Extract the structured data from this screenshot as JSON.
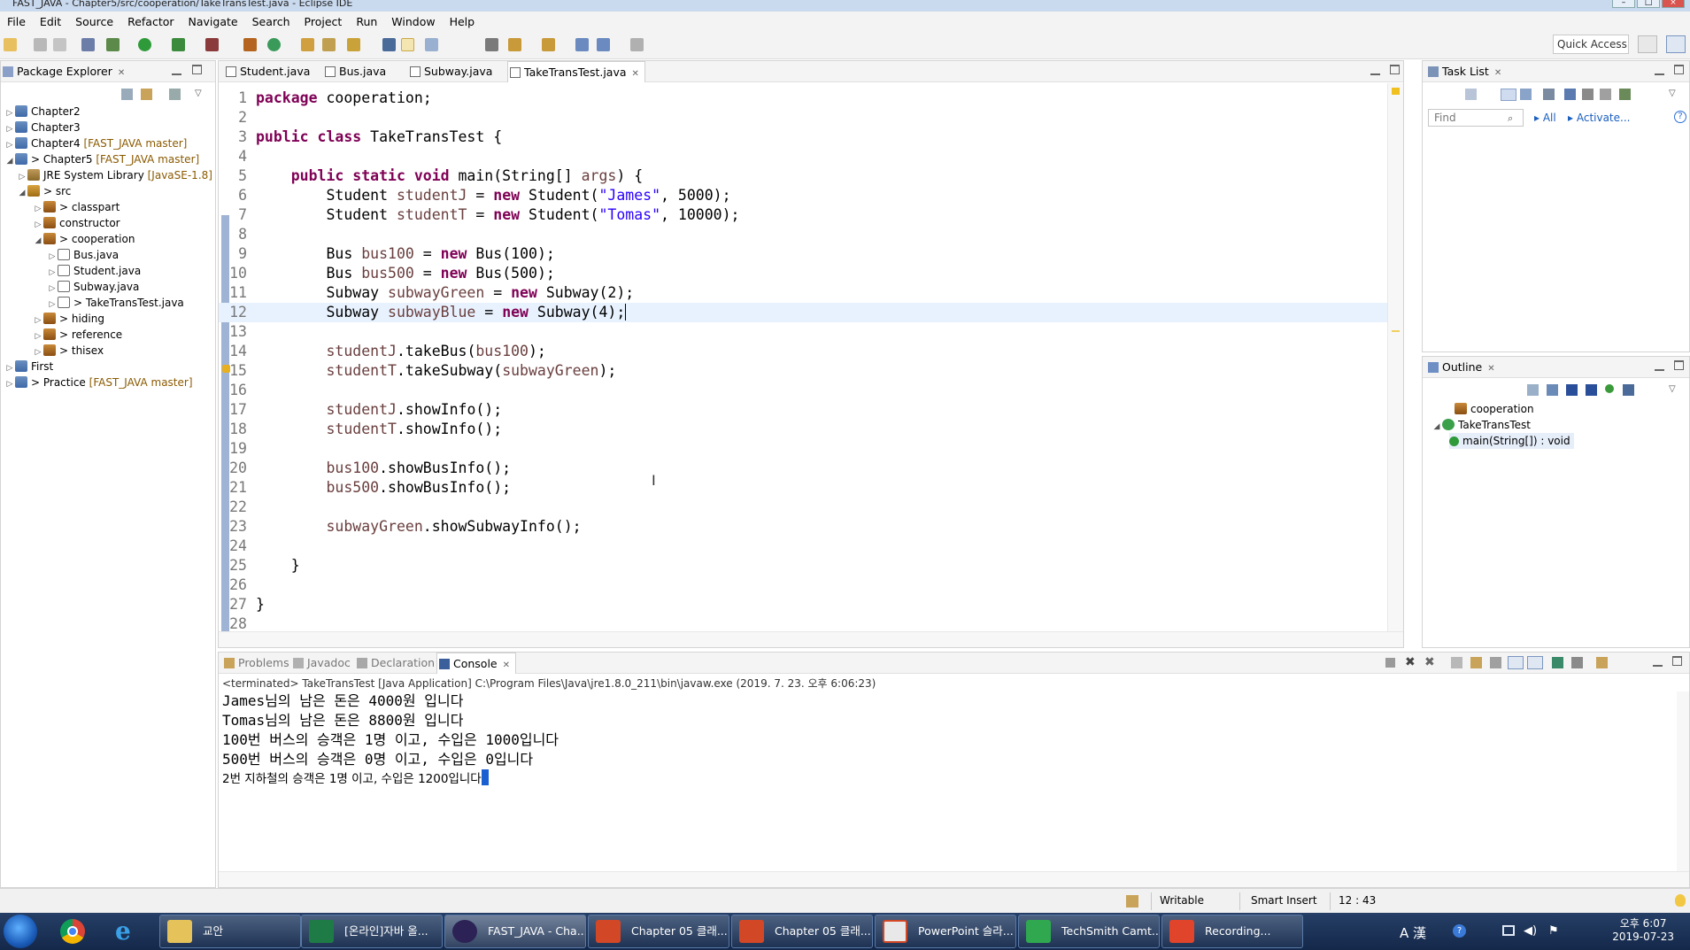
{
  "window": {
    "title": "FAST_JAVA - Chapter5/src/cooperation/TakeTransTest.java - Eclipse IDE"
  },
  "menu": [
    "File",
    "Edit",
    "Source",
    "Refactor",
    "Navigate",
    "Search",
    "Project",
    "Run",
    "Window",
    "Help"
  ],
  "toolbar": {
    "quick_access": "Quick Access"
  },
  "package_explorer": {
    "title": "Package Explorer",
    "items": [
      {
        "label": "Chapter2",
        "deco": ""
      },
      {
        "label": "Chapter3",
        "deco": ""
      },
      {
        "label": "Chapter4",
        "deco": "[FAST_JAVA master]"
      },
      {
        "label": "> Chapter5",
        "deco": "[FAST_JAVA master]"
      },
      {
        "label": "JRE System Library",
        "deco": "[JavaSE-1.8]"
      },
      {
        "label": "> src",
        "deco": ""
      },
      {
        "label": "> classpart",
        "deco": ""
      },
      {
        "label": "constructor",
        "deco": ""
      },
      {
        "label": "> cooperation",
        "deco": ""
      },
      {
        "label": "Bus.java",
        "deco": ""
      },
      {
        "label": "Student.java",
        "deco": ""
      },
      {
        "label": "Subway.java",
        "deco": ""
      },
      {
        "label": "> TakeTransTest.java",
        "deco": ""
      },
      {
        "label": "> hiding",
        "deco": ""
      },
      {
        "label": "> reference",
        "deco": ""
      },
      {
        "label": "> thisex",
        "deco": ""
      },
      {
        "label": "First",
        "deco": ""
      },
      {
        "label": "> Practice",
        "deco": "[FAST_JAVA master]"
      }
    ]
  },
  "editor": {
    "tabs": [
      "Student.java",
      "Bus.java",
      "Subway.java",
      "TakeTransTest.java"
    ],
    "lines": [
      "1",
      "2",
      "3",
      "4",
      "5",
      "6",
      "7",
      "8",
      "9",
      "10",
      "11",
      "12",
      "13",
      "14",
      "15",
      "16",
      "17",
      "18",
      "19",
      "20",
      "21",
      "22",
      "23",
      "24",
      "25",
      "26",
      "27",
      "28"
    ],
    "code": {
      "l1_kw": "package",
      "l1_rest": " cooperation;",
      "l3_kw": "public class",
      "l3_rest": " TakeTransTest {",
      "l5_kw": "public static void",
      "l5_rest": " main(String[] ",
      "l5_args": "args",
      "l5_end": ") {",
      "l6_pre": "Student ",
      "l6_var": "studentJ",
      "l6_eq": " = ",
      "l6_new": "new",
      "l6_mid": " Student(",
      "l6_str": "\"James\"",
      "l6_end": ", 5000);",
      "l7_pre": "Student ",
      "l7_var": "studentT",
      "l7_eq": " = ",
      "l7_new": "new",
      "l7_mid": " Student(",
      "l7_str": "\"Tomas\"",
      "l7_end": ", 10000);",
      "l9_pre": "Bus ",
      "l9_var": "bus100",
      "l9_eq": " = ",
      "l9_new": "new",
      "l9_end": " Bus(100);",
      "l10_pre": "Bus ",
      "l10_var": "bus500",
      "l10_eq": " = ",
      "l10_new": "new",
      "l10_end": " Bus(500);",
      "l11_pre": "Subway ",
      "l11_var": "subwayGreen",
      "l11_eq": " = ",
      "l11_new": "new",
      "l11_end": " Subway(2);",
      "l12_pre": "Subway ",
      "l12_var": "subwayBlue",
      "l12_eq": " = ",
      "l12_new": "new",
      "l12_end": " Subway(4);",
      "l14_var": "studentJ",
      "l14_mid": ".takeBus(",
      "l14_arg": "bus100",
      "l14_end": ");",
      "l15_var": "studentT",
      "l15_mid": ".takeSubway(",
      "l15_arg": "subwayGreen",
      "l15_end": ");",
      "l17_var": "studentJ",
      "l17_end": ".showInfo();",
      "l18_var": "studentT",
      "l18_end": ".showInfo();",
      "l20_var": "bus100",
      "l20_end": ".showBusInfo();",
      "l21_var": "bus500",
      "l21_end": ".showBusInfo();",
      "l23_var": "subwayGreen",
      "l23_end": ".showSubwayInfo();",
      "l25": "}",
      "l27": "}"
    }
  },
  "task_list": {
    "title": "Task List",
    "find_placeholder": "Find",
    "all": "All",
    "activate": "Activate..."
  },
  "outline": {
    "title": "Outline",
    "items": [
      "cooperation",
      "TakeTransTest",
      "main(String[]) : void"
    ]
  },
  "bottom_tabs": [
    "Problems",
    "Javadoc",
    "Declaration",
    "Console"
  ],
  "console": {
    "status": "<terminated> TakeTransTest [Java Application] C:\\Program Files\\Java\\jre1.8.0_211\\bin\\javaw.exe (2019. 7. 23. 오후 6:06:23)",
    "output": [
      "James님의 남은 돈은 4000원 입니다",
      "Tomas님의 남은 돈은 8800원 입니다",
      "100번 버스의 승객은 1명 이고, 수입은 1000입니다",
      "500번 버스의 승객은 0명 이고, 수입은 0입니다",
      "2번 지하철의 승객은 1명 이고, 수입은 1200입니다"
    ]
  },
  "statusbar": {
    "writable": "Writable",
    "insert_mode": "Smart Insert",
    "position": "12 : 43"
  },
  "taskbar": {
    "buttons": [
      "교안",
      "[온라인]자바 올...",
      "FAST_JAVA - Cha...",
      "Chapter 05 클래...",
      "Chapter 05 클래...",
      "PowerPoint 슬라...",
      "TechSmith Camt...",
      "Recording..."
    ],
    "clock_time": "오후 6:07",
    "clock_date": "2019-07-23",
    "ime": "A 漢"
  }
}
